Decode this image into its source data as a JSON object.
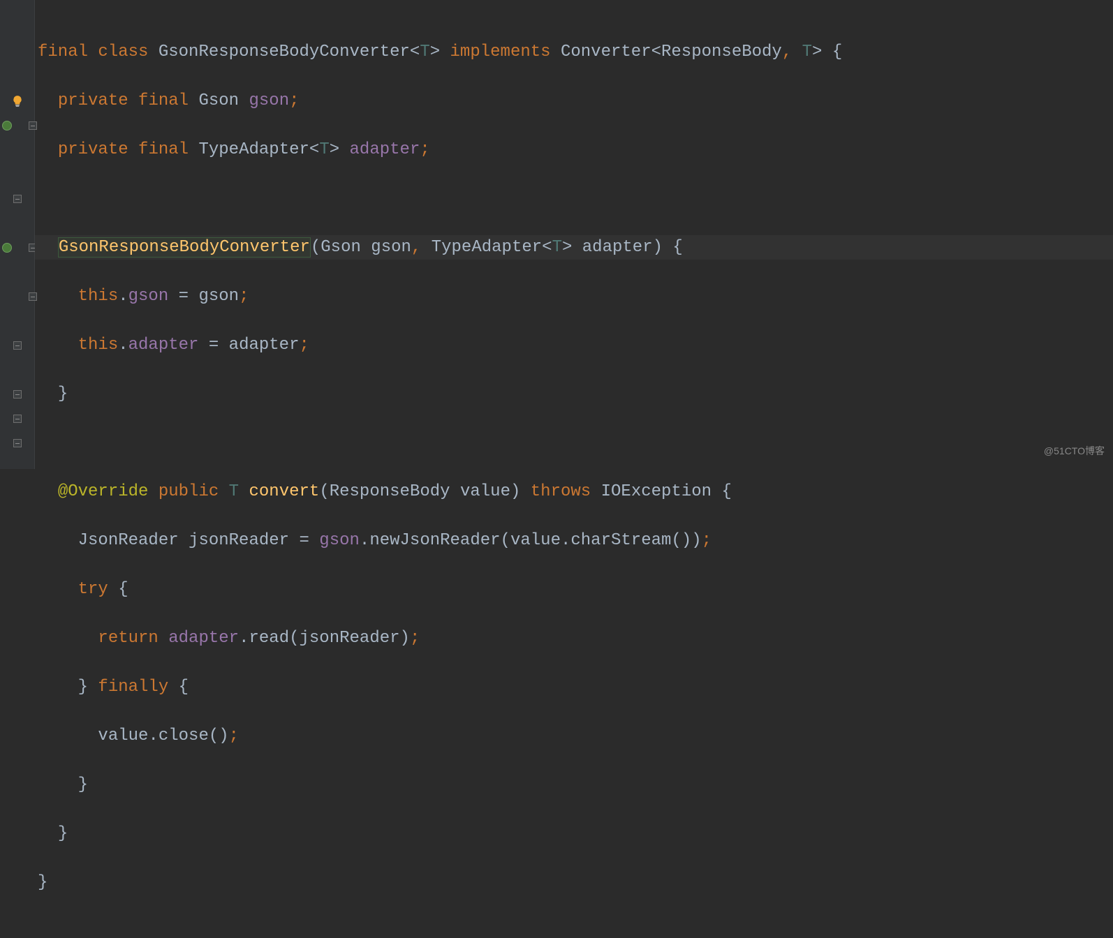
{
  "code": {
    "l1": {
      "kw_final": "final",
      "kw_class": "class",
      "cls": "GsonResponseBodyConverter",
      "lt": "<",
      "T": "T",
      "gt": ">",
      "kw_impl": "implements",
      "iface": "Converter",
      "lt2": "<",
      "rb": "ResponseBody",
      "comma": ",",
      "sp": " ",
      "T2": "T",
      "gt2": ">",
      "brace": " {"
    },
    "l2": {
      "kw_private": "private",
      "kw_final": "final",
      "type": "Gson",
      "name": "gson",
      "semi": ";"
    },
    "l3": {
      "kw_private": "private",
      "kw_final": "final",
      "type": "TypeAdapter",
      "lt": "<",
      "T": "T",
      "gt": ">",
      "name": "adapter",
      "semi": ";"
    },
    "l5": {
      "ctor": "GsonResponseBodyConverter",
      "lp": "(",
      "p1t": "Gson",
      "p1n": "gson",
      "comma": ",",
      "p2t": "TypeAdapter",
      "lt": "<",
      "T": "T",
      "gt": ">",
      "p2n": "adapter",
      "rp": ")",
      "brace": " {"
    },
    "l6": {
      "this": "this",
      "dot": ".",
      "field": "gson",
      "eq": " = ",
      "rhs": "gson",
      "semi": ";"
    },
    "l7": {
      "this": "this",
      "dot": ".",
      "field": "adapter",
      "eq": " = ",
      "rhs": "adapter",
      "semi": ";"
    },
    "l8": {
      "brace": "}"
    },
    "l10": {
      "anno": "@Override",
      "kw_public": "public",
      "ret": "T",
      "name": "convert",
      "lp": "(",
      "p1t": "ResponseBody",
      "p1n": "value",
      "rp": ")",
      "kw_throws": "throws",
      "exc": "IOException",
      "brace": " {"
    },
    "l11": {
      "type": "JsonReader",
      "var": "jsonReader",
      "eq": " = ",
      "obj": "gson",
      "dot": ".",
      "method": "newJsonReader",
      "lp": "(",
      "arg": "value",
      "dot2": ".",
      "method2": "charStream",
      "lp2": "(",
      "rp2": ")",
      "rp": ")",
      "semi": ";"
    },
    "l12": {
      "kw": "try",
      "brace": " {"
    },
    "l13": {
      "kw": "return",
      "obj": "adapter",
      "dot": ".",
      "method": "read",
      "lp": "(",
      "arg": "jsonReader",
      "rp": ")",
      "semi": ";"
    },
    "l14": {
      "brace": "}",
      "kw": "finally",
      "brace2": " {"
    },
    "l15": {
      "obj": "value",
      "dot": ".",
      "method": "close",
      "lp": "(",
      "rp": ")",
      "semi": ";"
    },
    "l16": {
      "brace": "}"
    },
    "l17": {
      "brace": "}"
    },
    "l18": {
      "brace": "}"
    }
  },
  "watermark": "@51CTO博客"
}
